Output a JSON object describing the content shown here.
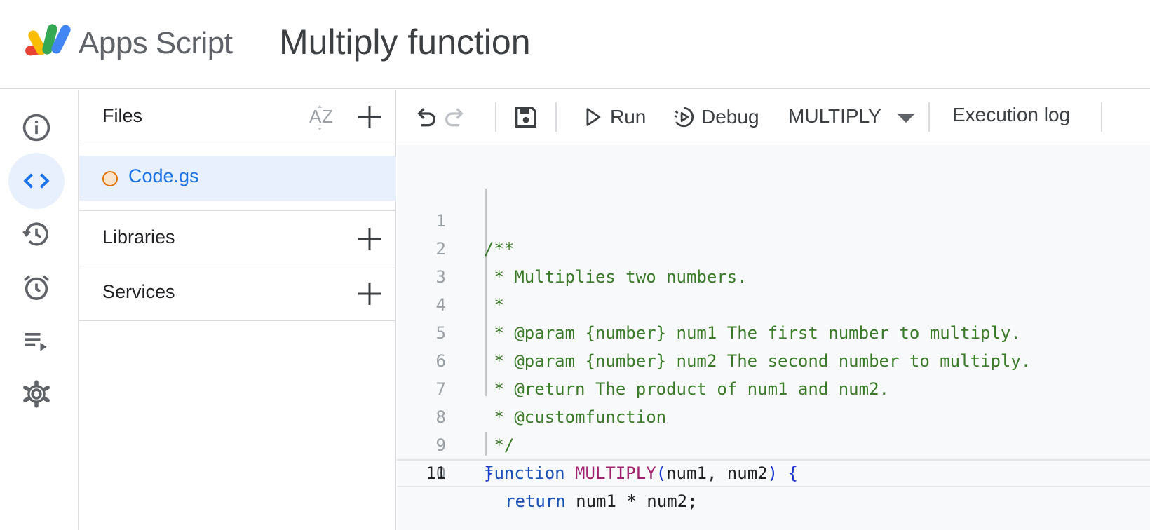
{
  "header": {
    "brand": "Apps Script",
    "project_title": "Multiply function"
  },
  "rail": {
    "items": [
      {
        "name": "overview",
        "icon": "info-icon"
      },
      {
        "name": "editor",
        "icon": "code-icon",
        "active": true
      },
      {
        "name": "project-history",
        "icon": "history-icon"
      },
      {
        "name": "triggers",
        "icon": "alarm-clock-icon"
      },
      {
        "name": "executions",
        "icon": "playlist-play-icon"
      },
      {
        "name": "project-settings",
        "icon": "gear-icon"
      }
    ]
  },
  "files_panel": {
    "files_label": "Files",
    "files": [
      {
        "name": "Code.gs",
        "selected": true
      }
    ],
    "libraries_label": "Libraries",
    "services_label": "Services"
  },
  "toolbar": {
    "run_label": "Run",
    "debug_label": "Debug",
    "function_selected": "MULTIPLY",
    "execution_log_label": "Execution log"
  },
  "editor": {
    "current_line": 11,
    "lines": [
      "/**",
      " * Multiplies two numbers.",
      " *",
      " * @param {number} num1 The first number to multiply.",
      " * @param {number} num2 The second number to multiply.",
      " * @return The product of num1 and num2.",
      " * @customfunction",
      " */",
      "function MULTIPLY(num1, num2) {",
      "  return num1 * num2;",
      "}"
    ],
    "tokens": {
      "kw_function": "function",
      "fn_name": "MULTIPLY",
      "paren_open": "(",
      "params": "num1, num2",
      "paren_close_brace": ") {",
      "kw_return": "return",
      "return_expr": " num1 * num2;",
      "brace_close": "}"
    }
  },
  "colors": {
    "accent": "#1a73e8",
    "active_bg": "#e8f0fe",
    "comment": "#3a7b28",
    "keyword": "#1a4fb4",
    "function_name": "#a3206e"
  }
}
